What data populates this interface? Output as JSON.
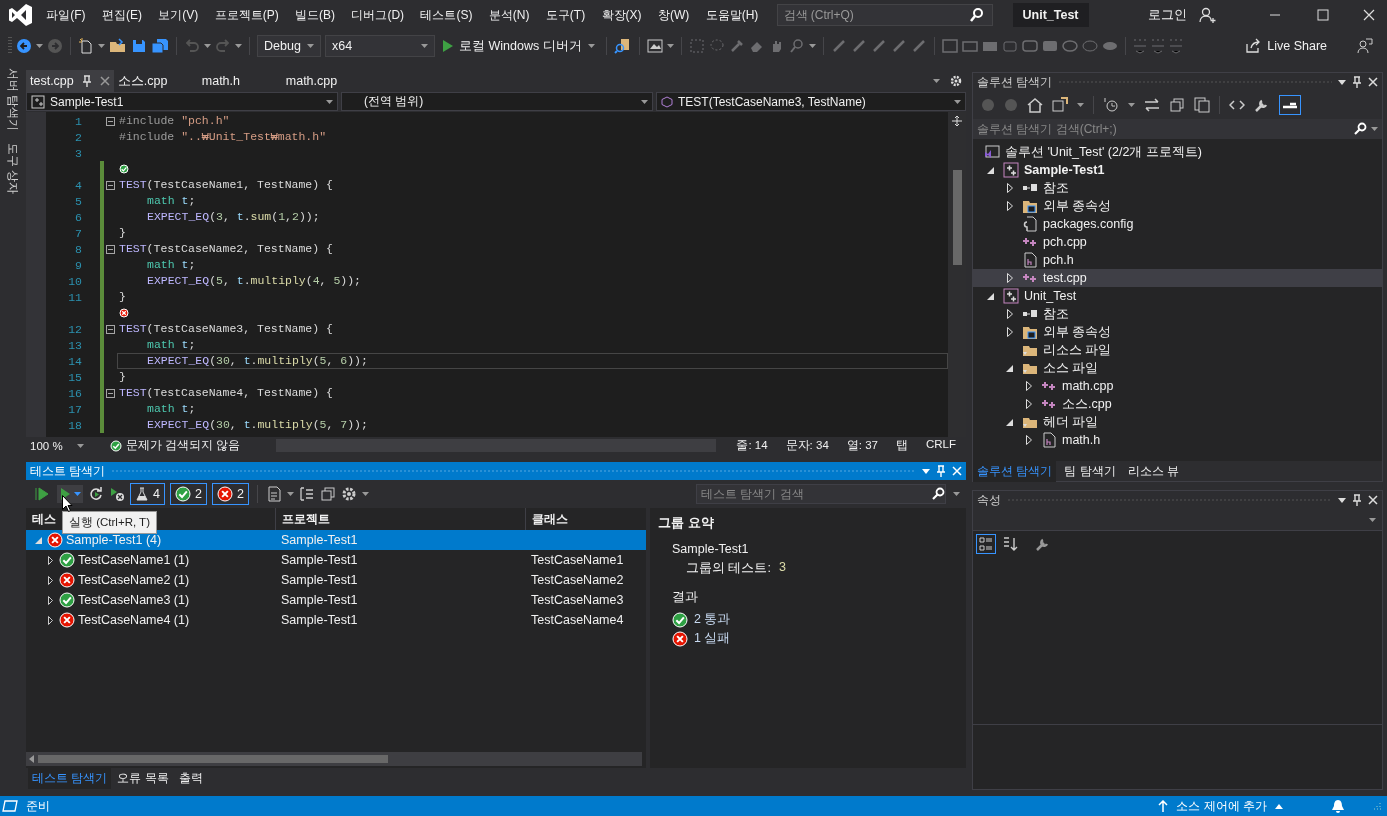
{
  "window": {
    "title": "Unit_Test"
  },
  "menu": [
    "파일(F)",
    "편집(E)",
    "보기(V)",
    "프로젝트(P)",
    "빌드(B)",
    "디버그(D)",
    "테스트(S)",
    "분석(N)",
    "도구(T)",
    "확장(X)",
    "창(W)",
    "도움말(H)"
  ],
  "search": {
    "placeholder": "검색 (Ctrl+Q)"
  },
  "account": "로그인",
  "toolbar": {
    "configuration": "Debug",
    "platform": "x64",
    "debugger": "로컬 Windows 디버거",
    "live_share": "Live Share"
  },
  "side_strip": [
    "서버 탐색기",
    "도구 상자"
  ],
  "editor": {
    "tabs": [
      {
        "label": "test.cpp",
        "selected": true
      },
      {
        "label": "소스.cpp",
        "selected": false
      },
      {
        "label": "math.h",
        "selected": false
      },
      {
        "label": "math.cpp",
        "selected": false
      }
    ],
    "nav": {
      "project": "Sample-Test1",
      "scope": "(전역 범위)",
      "member": "TEST(TestCaseName3, TestName)"
    },
    "lines": [
      {
        "kind": "code",
        "number": "1",
        "fold": true,
        "modified": false,
        "current": false,
        "indented": false,
        "tokens": [
          {
            "text": "#include ",
            "kind": "directive"
          },
          {
            "text": "\"pch.h\"",
            "kind": "string"
          }
        ]
      },
      {
        "kind": "code",
        "number": "2",
        "fold": false,
        "modified": false,
        "current": false,
        "indented": false,
        "tokens": [
          {
            "text": "#include ",
            "kind": "directive"
          },
          {
            "text": "\"..₩Unit_Test₩math.h\"",
            "kind": "string"
          }
        ]
      },
      {
        "kind": "code",
        "number": "3",
        "fold": false,
        "modified": false
      },
      {
        "kind": "lens",
        "passed": true,
        "modified": true
      },
      {
        "kind": "code",
        "number": "4",
        "fold": true,
        "modified": true,
        "current": false,
        "indented": false,
        "tokens": [
          {
            "text": "TEST",
            "kind": "macro"
          },
          {
            "text": "(TestCaseName1, TestName) {",
            "kind": "plain"
          }
        ]
      },
      {
        "kind": "code",
        "number": "5",
        "fold": false,
        "modified": true,
        "current": false,
        "indented": true,
        "tokens": [
          {
            "text": "math ",
            "kind": "type"
          },
          {
            "text": "t",
            "kind": "variable"
          },
          {
            "text": ";",
            "kind": "plain"
          }
        ]
      },
      {
        "kind": "code",
        "number": "6",
        "fold": false,
        "modified": true,
        "current": false,
        "indented": true,
        "tokens": [
          {
            "text": "EXPECT_EQ",
            "kind": "macro"
          },
          {
            "text": "(",
            "kind": "plain"
          },
          {
            "text": "3",
            "kind": "number"
          },
          {
            "text": ", ",
            "kind": "plain"
          },
          {
            "text": "t",
            "kind": "variable"
          },
          {
            "text": ".",
            "kind": "plain"
          },
          {
            "text": "sum",
            "kind": "function"
          },
          {
            "text": "(",
            "kind": "plain"
          },
          {
            "text": "1",
            "kind": "number"
          },
          {
            "text": ",",
            "kind": "plain"
          },
          {
            "text": "2",
            "kind": "number"
          },
          {
            "text": "));",
            "kind": "plain"
          }
        ]
      },
      {
        "kind": "code",
        "number": "7",
        "fold": false,
        "modified": true,
        "current": false,
        "indented": false,
        "tokens": [
          {
            "text": "}",
            "kind": "plain"
          }
        ]
      },
      {
        "kind": "code",
        "number": "8",
        "fold": true,
        "modified": true,
        "current": false,
        "indented": false,
        "tokens": [
          {
            "text": "TEST",
            "kind": "macro"
          },
          {
            "text": "(TestCaseName2, TestName) {",
            "kind": "plain"
          }
        ]
      },
      {
        "kind": "code",
        "number": "9",
        "fold": false,
        "modified": true,
        "current": false,
        "indented": true,
        "tokens": [
          {
            "text": "math ",
            "kind": "type"
          },
          {
            "text": "t",
            "kind": "variable"
          },
          {
            "text": ";",
            "kind": "plain"
          }
        ]
      },
      {
        "kind": "code",
        "number": "10",
        "fold": false,
        "modified": true,
        "current": false,
        "indented": true,
        "tokens": [
          {
            "text": "EXPECT_EQ",
            "kind": "macro"
          },
          {
            "text": "(",
            "kind": "plain"
          },
          {
            "text": "5",
            "kind": "number"
          },
          {
            "text": ", ",
            "kind": "plain"
          },
          {
            "text": "t",
            "kind": "variable"
          },
          {
            "text": ".",
            "kind": "plain"
          },
          {
            "text": "multiply",
            "kind": "function"
          },
          {
            "text": "(",
            "kind": "plain"
          },
          {
            "text": "4",
            "kind": "number"
          },
          {
            "text": ", ",
            "kind": "plain"
          },
          {
            "text": "5",
            "kind": "number"
          },
          {
            "text": "));",
            "kind": "plain"
          }
        ]
      },
      {
        "kind": "code",
        "number": "11",
        "fold": false,
        "modified": true,
        "current": false,
        "indented": false,
        "tokens": [
          {
            "text": "}",
            "kind": "plain"
          }
        ]
      },
      {
        "kind": "lens",
        "passed": false,
        "modified": true
      },
      {
        "kind": "code",
        "number": "12",
        "fold": true,
        "modified": true,
        "current": false,
        "indented": false,
        "tokens": [
          {
            "text": "TEST",
            "kind": "macro"
          },
          {
            "text": "(TestCaseName3, TestName) {",
            "kind": "plain"
          }
        ]
      },
      {
        "kind": "code",
        "number": "13",
        "fold": false,
        "modified": true,
        "current": false,
        "indented": true,
        "tokens": [
          {
            "text": "math ",
            "kind": "type"
          },
          {
            "text": "t",
            "kind": "variable"
          },
          {
            "text": ";",
            "kind": "plain"
          }
        ]
      },
      {
        "kind": "code",
        "number": "14",
        "fold": false,
        "modified": true,
        "current": true,
        "indented": true,
        "tokens": [
          {
            "text": "EXPECT_EQ",
            "kind": "macro"
          },
          {
            "text": "(",
            "kind": "plain"
          },
          {
            "text": "30",
            "kind": "number"
          },
          {
            "text": ", ",
            "kind": "plain"
          },
          {
            "text": "t",
            "kind": "variable"
          },
          {
            "text": ".",
            "kind": "plain"
          },
          {
            "text": "multiply",
            "kind": "function"
          },
          {
            "text": "(",
            "kind": "plain"
          },
          {
            "text": "5",
            "kind": "number"
          },
          {
            "text": ", ",
            "kind": "plain"
          },
          {
            "text": "6",
            "kind": "number"
          },
          {
            "text": "));",
            "kind": "plain"
          }
        ]
      },
      {
        "kind": "code",
        "number": "15",
        "fold": false,
        "modified": true,
        "current": false,
        "indented": false,
        "tokens": [
          {
            "text": "}",
            "kind": "plain"
          }
        ]
      },
      {
        "kind": "code",
        "number": "16",
        "fold": true,
        "modified": true,
        "current": false,
        "indented": false,
        "tokens": [
          {
            "text": "TEST",
            "kind": "macro"
          },
          {
            "text": "(TestCaseName4, TestName) {",
            "kind": "plain"
          }
        ]
      },
      {
        "kind": "code",
        "number": "17",
        "fold": false,
        "modified": true,
        "current": false,
        "indented": true,
        "tokens": [
          {
            "text": "math ",
            "kind": "type"
          },
          {
            "text": "t",
            "kind": "variable"
          },
          {
            "text": ";",
            "kind": "plain"
          }
        ]
      },
      {
        "kind": "code",
        "number": "18",
        "fold": false,
        "modified": true,
        "current": false,
        "indented": true,
        "tokens": [
          {
            "text": "EXPECT_EQ",
            "kind": "macro"
          },
          {
            "text": "(",
            "kind": "plain"
          },
          {
            "text": "30",
            "kind": "number"
          },
          {
            "text": ", ",
            "kind": "plain"
          },
          {
            "text": "t",
            "kind": "variable"
          },
          {
            "text": ".",
            "kind": "plain"
          },
          {
            "text": "multiply",
            "kind": "function"
          },
          {
            "text": "(",
            "kind": "plain"
          },
          {
            "text": "5",
            "kind": "number"
          },
          {
            "text": ", ",
            "kind": "plain"
          },
          {
            "text": "7",
            "kind": "number"
          },
          {
            "text": "));",
            "kind": "plain"
          }
        ]
      }
    ],
    "status": {
      "zoom": "100 %",
      "issues": "문제가 검색되지 않음",
      "line": "줄: 14",
      "char": "문자: 34",
      "column": "열: 37",
      "indent": "탭",
      "eol": "CRLF"
    }
  },
  "test_explorer": {
    "title": "테스트 탐색기",
    "filters": [
      {
        "kind": "all",
        "count": "4",
        "selected": true
      },
      {
        "kind": "pass",
        "count": "2",
        "selected": true
      },
      {
        "kind": "fail",
        "count": "2",
        "selected": true
      }
    ],
    "search": {
      "placeholder": "테스트 탐색기 검색"
    },
    "tooltip": "실행 (Ctrl+R, T)",
    "columns": [
      "테스",
      "프로젝트",
      "클래스"
    ],
    "rows": [
      {
        "name": "Sample-Test1 (4)",
        "project": "Sample-Test1",
        "passed": false,
        "expanded": true,
        "selected": true,
        "children": [
          {
            "name": "TestCaseName1 (1)",
            "project": "Sample-Test1",
            "class": "TestCaseName1",
            "passed": true,
            "expanded": false,
            "selected": false
          },
          {
            "name": "TestCaseName2 (1)",
            "project": "Sample-Test1",
            "class": "TestCaseName2",
            "passed": false,
            "expanded": false,
            "selected": false
          },
          {
            "name": "TestCaseName3 (1)",
            "project": "Sample-Test1",
            "class": "TestCaseName3",
            "passed": true,
            "expanded": false,
            "selected": false
          },
          {
            "name": "TestCaseName4 (1)",
            "project": "Sample-Test1",
            "class": "TestCaseName4",
            "passed": false,
            "expanded": false,
            "selected": false
          }
        ]
      }
    ],
    "summary": {
      "title": "그룹 요약",
      "group": "Sample-Test1",
      "count_label": "그룹의 테스트:",
      "count": "3",
      "results_label": "결과",
      "results": [
        {
          "passed": true,
          "text": "2 통과"
        },
        {
          "passed": false,
          "text": "1 실패"
        }
      ]
    },
    "bottom_tabs": [
      {
        "label": "테스트 탐색기",
        "selected": true
      },
      {
        "label": "오류 목록",
        "selected": false
      },
      {
        "label": "출력",
        "selected": false
      }
    ]
  },
  "solution_explorer": {
    "title": "솔루션 탐색기",
    "search": {
      "placeholder": "솔루션 탐색기 검색(Ctrl+;)"
    },
    "tree": [
      {
        "label": "솔루션 'Unit_Test' (2/2개 프로젝트)",
        "kind": "solution",
        "selected": false,
        "children": [
          {
            "label": "Sample-Test1",
            "kind": "project",
            "startup": true,
            "expanded": true,
            "selected": false,
            "children": [
              {
                "label": "참조",
                "kind": "references",
                "expanded": false,
                "selected": false
              },
              {
                "label": "외부 종속성",
                "kind": "dependencies",
                "expanded": false,
                "selected": false
              },
              {
                "label": "packages.config",
                "kind": "config",
                "selected": false
              },
              {
                "label": "pch.cpp",
                "kind": "cpp",
                "selected": false
              },
              {
                "label": "pch.h",
                "kind": "header",
                "selected": false
              },
              {
                "label": "test.cpp",
                "kind": "cpp",
                "expanded": false,
                "selected": true
              }
            ]
          },
          {
            "label": "Unit_Test",
            "kind": "project",
            "startup": false,
            "expanded": true,
            "selected": false,
            "children": [
              {
                "label": "참조",
                "kind": "references",
                "expanded": false,
                "selected": false
              },
              {
                "label": "외부 종속성",
                "kind": "dependencies",
                "expanded": false,
                "selected": false
              },
              {
                "label": "리소스 파일",
                "kind": "folder",
                "selected": false
              },
              {
                "label": "소스 파일",
                "kind": "folder",
                "expanded": true,
                "selected": false,
                "children": [
                  {
                    "label": "math.cpp",
                    "kind": "cpp",
                    "expanded": false,
                    "selected": false
                  },
                  {
                    "label": "소스.cpp",
                    "kind": "cpp",
                    "expanded": false,
                    "selected": false
                  }
                ]
              },
              {
                "label": "헤더 파일",
                "kind": "folder",
                "expanded": true,
                "selected": false,
                "children": [
                  {
                    "label": "math.h",
                    "kind": "header",
                    "expanded": false,
                    "selected": false
                  }
                ]
              }
            ]
          }
        ]
      }
    ],
    "bottom_tabs": [
      {
        "label": "솔루션 탐색기",
        "selected": true
      },
      {
        "label": "팀 탐색기",
        "selected": false
      },
      {
        "label": "리소스 뷰",
        "selected": false
      }
    ]
  },
  "properties": {
    "title": "속성"
  },
  "status_bar": {
    "state": "준비",
    "source_control": "소스 제어에 추가"
  }
}
